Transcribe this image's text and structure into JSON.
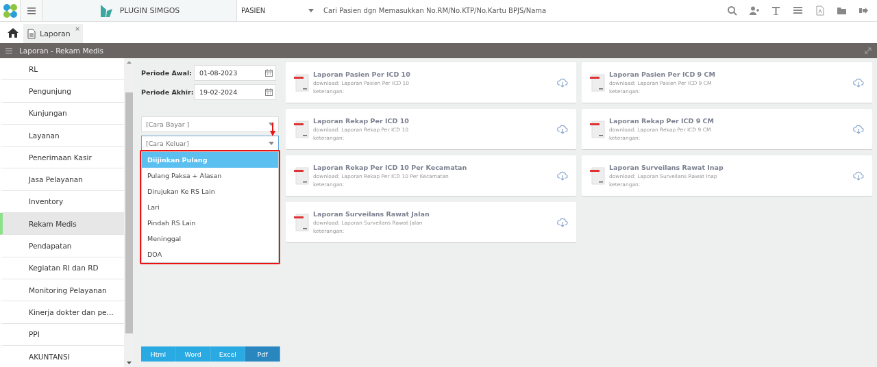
{
  "topbar": {
    "app_name": "PLUGIN SIMGOS",
    "search_category": "PASIEN",
    "search_placeholder": "Cari Pasien dgn Memasukkan No.RM/No.KTP/No.Kartu BPJS/Nama"
  },
  "tabs": [
    {
      "label": "Laporan",
      "close": "×",
      "selected": true
    }
  ],
  "panel": {
    "title": "Laporan - Rekam Medis"
  },
  "sidebar": {
    "items": [
      {
        "label": "RL",
        "selected": false
      },
      {
        "label": "Pengunjung",
        "selected": false
      },
      {
        "label": "Kunjungan",
        "selected": false
      },
      {
        "label": "Layanan",
        "selected": false
      },
      {
        "label": "Penerimaan Kasir",
        "selected": false
      },
      {
        "label": "Jasa Pelayanan",
        "selected": false
      },
      {
        "label": "Inventory",
        "selected": false
      },
      {
        "label": "Rekam Medis",
        "selected": true
      },
      {
        "label": "Pendapatan",
        "selected": false
      },
      {
        "label": "Kegiatan RI dan RD",
        "selected": false
      },
      {
        "label": "Monitoring Pelayanan",
        "selected": false
      },
      {
        "label": "Kinerja dokter dan pe...",
        "selected": false
      },
      {
        "label": "PPI",
        "selected": false
      },
      {
        "label": "AKUNTANSI",
        "selected": false
      }
    ]
  },
  "filters": {
    "fields": [
      {
        "label": "Periode Awal:",
        "value": "01-08-2023"
      },
      {
        "label": "Periode Akhir:",
        "value": "19-02-2024"
      }
    ],
    "selects": [
      {
        "placeholder": "[Cara Bayar ]",
        "focused": false
      },
      {
        "placeholder": "[Cara Keluar]",
        "focused": true
      }
    ],
    "dropdown_options": [
      {
        "label": "Diijinkan Pulang",
        "selected": true
      },
      {
        "label": "Pulang Paksa + Alasan",
        "selected": false
      },
      {
        "label": "Dirujukan Ke RS Lain",
        "selected": false
      },
      {
        "label": "Lari",
        "selected": false
      },
      {
        "label": "Pindah RS Lain",
        "selected": false
      },
      {
        "label": "Meninggal",
        "selected": false
      },
      {
        "label": "DOA",
        "selected": false
      }
    ],
    "formats": [
      {
        "label": "Html",
        "selected": false
      },
      {
        "label": "Word",
        "selected": false
      },
      {
        "label": "Excel",
        "selected": false
      },
      {
        "label": "Pdf",
        "selected": true
      }
    ]
  },
  "reports": {
    "columns": [
      [
        {
          "title": "Laporan Pasien Per ICD 10",
          "download": "download: Laporan Pasien Per ICD 10",
          "note": "keterangan:"
        },
        {
          "title": "Laporan Rekap Per ICD 10",
          "download": "download: Laporan Rekap Per ICD 10",
          "note": "keterangan:"
        },
        {
          "title": "Laporan Rekap Per ICD 10 Per Kecamatan",
          "download": "download: Laporan Rekap Per ICD 10 Per Kecamatan",
          "note": "keterangan:"
        },
        {
          "title": "Laporan Surveilans Rawat Jalan",
          "download": "download: Laporan Surveilans Rawat Jalan",
          "note": "keterangan:"
        }
      ],
      [
        {
          "title": "Laporan Pasien Per ICD 9 CM",
          "download": "download: Laporan Pasien Per ICD 9 CM",
          "note": "keterangan:"
        },
        {
          "title": "Laporan Rekap Per ICD 9 CM",
          "download": "download: Laporan Rekap Per ICD 9 CM",
          "note": "keterangan:"
        },
        {
          "title": "Laporan Surveilans Rawat Inap",
          "download": "download: Laporan Surveilans Rawat Inap",
          "note": "keterangan:"
        }
      ]
    ]
  }
}
